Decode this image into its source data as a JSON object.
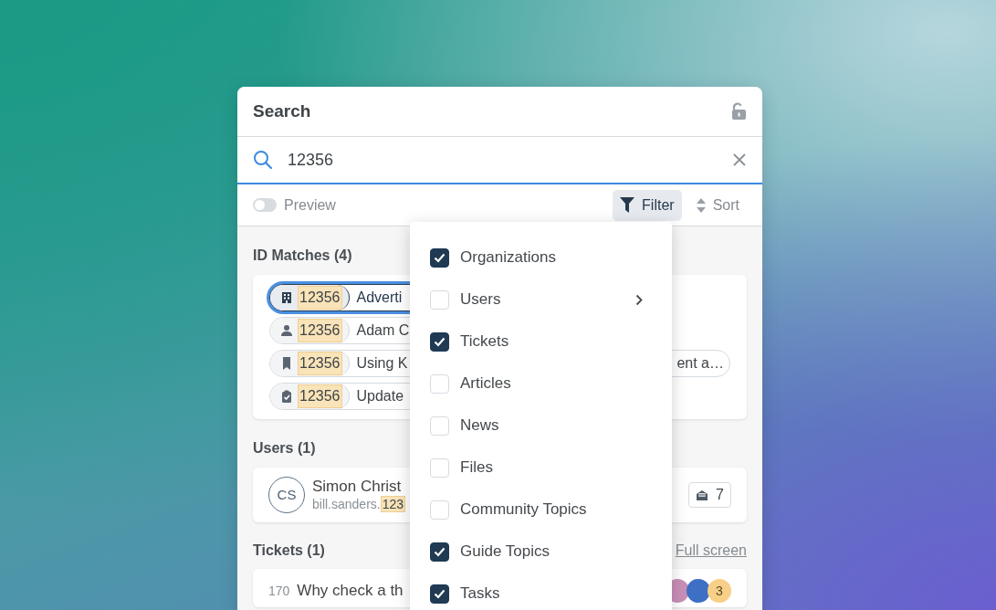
{
  "panel": {
    "title": "Search",
    "search": {
      "value": "12356"
    },
    "preview": {
      "label": "Preview",
      "on": false
    },
    "filter": {
      "label": "Filter",
      "selected": true
    },
    "sort": {
      "label": "Sort",
      "selected": false
    },
    "id_matches": {
      "heading": "ID Matches (4)",
      "items": [
        {
          "kind": "organization",
          "id": "12356",
          "title": "Adverti",
          "focused": true
        },
        {
          "kind": "user",
          "id": "12356",
          "title": "Adam C",
          "focused": false
        },
        {
          "kind": "article",
          "id": "12356",
          "title": "Using K",
          "title_tail": "ent a…",
          "focused": false
        },
        {
          "kind": "task",
          "id": "12356",
          "title": "Update",
          "focused": false
        }
      ]
    },
    "users": {
      "heading": "Users (1)",
      "items": [
        {
          "initials": "CS",
          "name": "Simon Christ",
          "email": "bill.sanders.",
          "email_match": "123",
          "ticket_count": "7"
        }
      ]
    },
    "tickets": {
      "heading": "Tickets (1)",
      "action": "Full screen",
      "items": [
        {
          "number": "170",
          "title": "Why check a th",
          "extra_count": "3"
        }
      ]
    }
  },
  "filter_menu": {
    "items": [
      {
        "label": "Organizations",
        "checked": true,
        "submenu": false
      },
      {
        "label": "Users",
        "checked": false,
        "submenu": true
      },
      {
        "label": "Tickets",
        "checked": true,
        "submenu": false
      },
      {
        "label": "Articles",
        "checked": false,
        "submenu": false
      },
      {
        "label": "News",
        "checked": false,
        "submenu": false
      },
      {
        "label": "Files",
        "checked": false,
        "submenu": false
      },
      {
        "label": "Community Topics",
        "checked": false,
        "submenu": false
      },
      {
        "label": "Guide Topics",
        "checked": true,
        "submenu": false
      },
      {
        "label": "Tasks",
        "checked": true,
        "submenu": false
      }
    ]
  }
}
